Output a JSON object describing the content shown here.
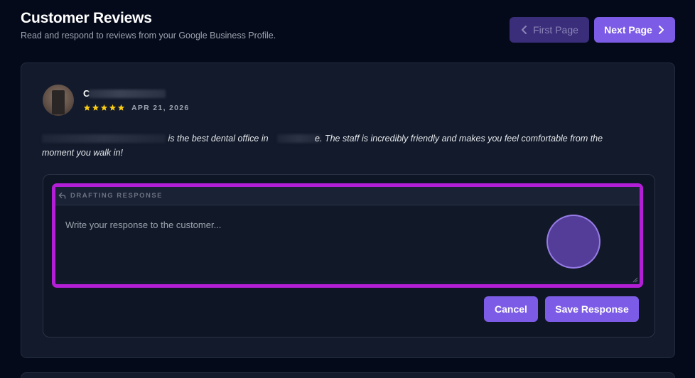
{
  "header": {
    "title": "Customer Reviews",
    "subtitle": "Read and respond to reviews from your Google Business Profile."
  },
  "pagination": {
    "first_label": "First Page",
    "next_label": "Next Page"
  },
  "review": {
    "reviewer_name_visible": "C",
    "rating": 5,
    "date": "APR 21, 2026",
    "text_segment_1": "is the best dental office in",
    "text_segment_2": "e. The staff is incredibly friendly and makes you feel comfortable from the",
    "text_line_2": "moment you walk in!"
  },
  "response": {
    "label": "DRAFTING RESPONSE",
    "placeholder": "Write your response to the customer...",
    "value": "",
    "cancel_label": "Cancel",
    "save_label": "Save Response"
  },
  "colors": {
    "accent": "#7c5ce6",
    "highlight": "#b31fd6",
    "star": "#facc15",
    "background": "#050a1a"
  }
}
